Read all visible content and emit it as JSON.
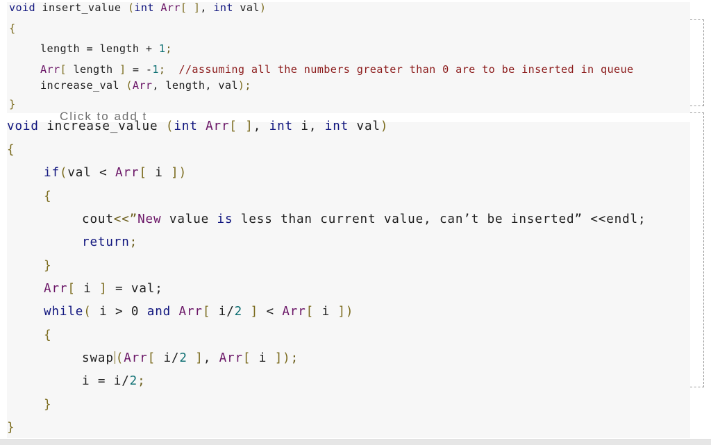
{
  "code_blocks": [
    {
      "name": "insert_value",
      "lines": {
        "sig_kw": "void",
        "sig_name": " insert_value ",
        "sig_open": "(",
        "sig_int1": "int",
        "sig_arr": " Arr",
        "sig_brackets": "[ ]",
        "sig_comma": ", ",
        "sig_int2": "int",
        "sig_val": " val",
        "sig_close": ")",
        "open_brace": "{",
        "l1_a": "length = length + ",
        "l1_num": "1",
        "l1_end": ";",
        "l2_arr": "Arr",
        "l2_b1": "[",
        "l2_mid": " length ",
        "l2_b2": "]",
        "l2_eq": " = -",
        "l2_num": "1",
        "l2_end": ";  ",
        "l2_comment": "//assuming all the numbers greater than 0 are to be inserted in queue",
        "l3_a": "increase_val ",
        "l3_open": "(",
        "l3_arr": "Arr",
        "l3_rest": ", length, val",
        "l3_close": ")",
        "l3_end": ";",
        "close_brace": "}"
      }
    },
    {
      "name": "increase_value",
      "lines": {
        "sig_kw": "void",
        "sig_name": " increase_value ",
        "sig_open": "(",
        "sig_int1": "int",
        "sig_arr": " Arr",
        "sig_brackets": "[ ]",
        "sig_comma": ", ",
        "sig_int2": "int",
        "sig_i": " i, ",
        "sig_int3": "int",
        "sig_val": " val",
        "sig_close": ")",
        "open_brace": "{",
        "if_kw": "if",
        "if_open": "(",
        "if_cond": "val < ",
        "if_arr": "Arr",
        "if_b1": "[",
        "if_i": " i ",
        "if_b2": "]",
        "if_close": ")",
        "if_open_brace": "{",
        "cout_a": "cout",
        "cout_op": "<<”",
        "cout_new": "New",
        "cout_b": " value ",
        "cout_is": "is",
        "cout_c": " less than current value, can’t be inserted” <<endl;",
        "return_kw": "return",
        "return_end": ";",
        "if_close_brace": "}",
        "assign_arr": "Arr",
        "assign_b1": "[",
        "assign_i": " i ",
        "assign_b2": "]",
        "assign_rest": " = val;",
        "while_kw": "while",
        "while_open": "(",
        "while_a": " i > 0 ",
        "while_and": "and",
        "while_arr1": " Arr",
        "while_b1": "[",
        "while_i2": " i/",
        "while_two": "2",
        "while_b2": " ]",
        "while_lt": " < ",
        "while_arr2": "Arr",
        "while_b3": "[",
        "while_i": " i ",
        "while_b4": "]",
        "while_close": ")",
        "while_open_brace": "{",
        "swap_a": "swap",
        "swap_open": "(",
        "swap_arr1": "Arr",
        "swap_b1": "[",
        "swap_i2": " i/",
        "swap_two": "2",
        "swap_b2": " ]",
        "swap_comma": ", ",
        "swap_arr2": "Arr",
        "swap_b3": "[",
        "swap_i": " i ",
        "swap_b4": "]",
        "swap_close": ")",
        "swap_end": ";",
        "half_a": "i = i/",
        "half_two": "2",
        "half_end": ";",
        "while_close_brace": "}",
        "close_brace": "}"
      }
    }
  ],
  "overlay_ghost_text": "Click to add t"
}
